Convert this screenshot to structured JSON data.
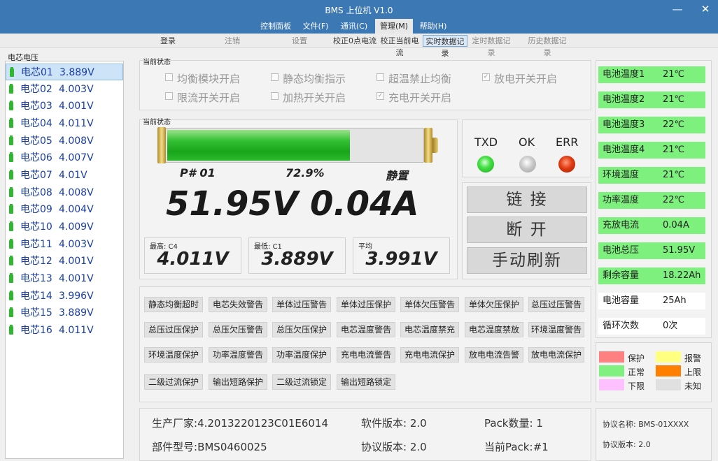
{
  "app": {
    "title": "BMS 上位机 V1.0"
  },
  "window": {
    "minimize_icon": "minimize-icon",
    "close_icon": "close-icon"
  },
  "menu": [
    {
      "label": "控制面板"
    },
    {
      "label": "文件(F)"
    },
    {
      "label": "通讯(C)"
    },
    {
      "label": "管理(M)"
    },
    {
      "label": "帮助(H)"
    }
  ],
  "toolbar": [
    {
      "label": "登录"
    },
    {
      "label": "注销"
    },
    {
      "label": "设置"
    },
    {
      "label": "校正0点电流"
    },
    {
      "label": "校正当前电流"
    },
    {
      "label": "实时数据记录"
    },
    {
      "label": "定时数据记录"
    },
    {
      "label": "历史数据记录"
    }
  ],
  "cells": {
    "header": "电芯电压",
    "items": [
      {
        "name": "电芯01",
        "voltage": "3.889V"
      },
      {
        "name": "电芯02",
        "voltage": "4.003V"
      },
      {
        "name": "电芯03",
        "voltage": "4.001V"
      },
      {
        "name": "电芯04",
        "voltage": "4.011V"
      },
      {
        "name": "电芯05",
        "voltage": "4.008V"
      },
      {
        "name": "电芯06",
        "voltage": "4.007V"
      },
      {
        "name": "电芯07",
        "voltage": "4.01V"
      },
      {
        "name": "电芯08",
        "voltage": "4.008V"
      },
      {
        "name": "电芯09",
        "voltage": "4.004V"
      },
      {
        "name": "电芯10",
        "voltage": "4.009V"
      },
      {
        "name": "电芯11",
        "voltage": "4.003V"
      },
      {
        "name": "电芯12",
        "voltage": "4.001V"
      },
      {
        "name": "电芯13",
        "voltage": "4.001V"
      },
      {
        "name": "电芯14",
        "voltage": "3.996V"
      },
      {
        "name": "电芯15",
        "voltage": "3.889V"
      },
      {
        "name": "电芯16",
        "voltage": "4.011V"
      }
    ]
  },
  "status": {
    "label": "当前状态",
    "checks": [
      {
        "label": "均衡模块开启",
        "checked": false
      },
      {
        "label": "静态均衡指示",
        "checked": false
      },
      {
        "label": "超温禁止均衡",
        "checked": false
      },
      {
        "label": "放电开关开启",
        "checked": true
      },
      {
        "label": "限流开关开启",
        "checked": false
      },
      {
        "label": "加热开关开启",
        "checked": false
      },
      {
        "label": "充电开关开启",
        "checked": true
      }
    ]
  },
  "pack": {
    "label": "当前状态",
    "soc_fraction": 0.729,
    "pack_id": "P# 01",
    "soc": "72.9%",
    "state": "静置",
    "voltage": "51.95V",
    "current": "0.04A",
    "max_label": "最高:",
    "max_cell": "C4",
    "max_value": "4.011V",
    "min_label": "最低:",
    "min_cell": "C1",
    "min_value": "3.889V",
    "avg_label": "平均",
    "avg_value": "3.991V"
  },
  "leds": [
    {
      "label": "TXD",
      "color": "#33dd33"
    },
    {
      "label": "OK",
      "color": "#c0c0c0"
    },
    {
      "label": "ERR",
      "color": "#d03010"
    }
  ],
  "actions": {
    "connect": "链  接",
    "disconnect": "断  开",
    "refresh": "手动刷新"
  },
  "alarms": [
    "静态均衡超时",
    "电芯失效警告",
    "单体过压警告",
    "单体过压保护",
    "单体欠压警告",
    "单体欠压保护",
    "总压过压警告",
    "总压过压保护",
    "总压欠压警告",
    "总压欠压保护",
    "电芯温度警告",
    "电芯温度禁充",
    "电芯温度禁放",
    "环境温度警告",
    "环境温度保护",
    "功率温度警告",
    "功率温度保护",
    "充电电流警告",
    "充电电流保护",
    "放电电流告警",
    "放电电流保护",
    "二级过流保护",
    "输出短路保护",
    "二级过流锁定",
    "输出短路锁定"
  ],
  "device": {
    "manufacturer_label": "生产厂家:",
    "manufacturer": "4.2013220123C01E6014",
    "sw_label": "软件版本:",
    "sw_version": "2.0",
    "pack_count_label": "Pack数量:",
    "pack_count": "1",
    "model_label": "部件型号:",
    "model": "BMS0460025",
    "proto_label": "协议版本:",
    "proto_version": "2.0",
    "current_pack_label": "当前Pack:",
    "current_pack": "#1"
  },
  "readings": [
    {
      "key": "电池温度1",
      "value": "21℃",
      "status": "normal"
    },
    {
      "key": "电池温度2",
      "value": "21℃",
      "status": "normal"
    },
    {
      "key": "电池温度3",
      "value": "22℃",
      "status": "normal"
    },
    {
      "key": "电池温度4",
      "value": "21℃",
      "status": "normal"
    },
    {
      "key": "环境温度",
      "value": "21℃",
      "status": "normal"
    },
    {
      "key": "功率温度",
      "value": "22℃",
      "status": "normal"
    },
    {
      "key": "充放电流",
      "value": "0.04A",
      "status": "normal"
    },
    {
      "key": "电池总压",
      "value": "51.95V",
      "status": "normal"
    },
    {
      "key": "剩余容量",
      "value": "18.22Ah",
      "status": "normal"
    },
    {
      "key": "电池容量",
      "value": "25Ah",
      "status": "unknown"
    },
    {
      "key": "循环次数",
      "value": "0次",
      "status": "unknown"
    }
  ],
  "legend": [
    {
      "label": "保护",
      "color": "#ff8080"
    },
    {
      "label": "报警",
      "color": "#ffff80"
    },
    {
      "label": "正常",
      "color": "#80f080"
    },
    {
      "label": "上限",
      "color": "#ff8000"
    },
    {
      "label": "下限",
      "color": "#ffc0ff"
    },
    {
      "label": "未知",
      "color": "#e0e0e0"
    }
  ],
  "protocol": {
    "name_label": "协议名称:",
    "name": "BMS-01XXXX",
    "version_label": "协议版本:",
    "version": "2.0"
  }
}
